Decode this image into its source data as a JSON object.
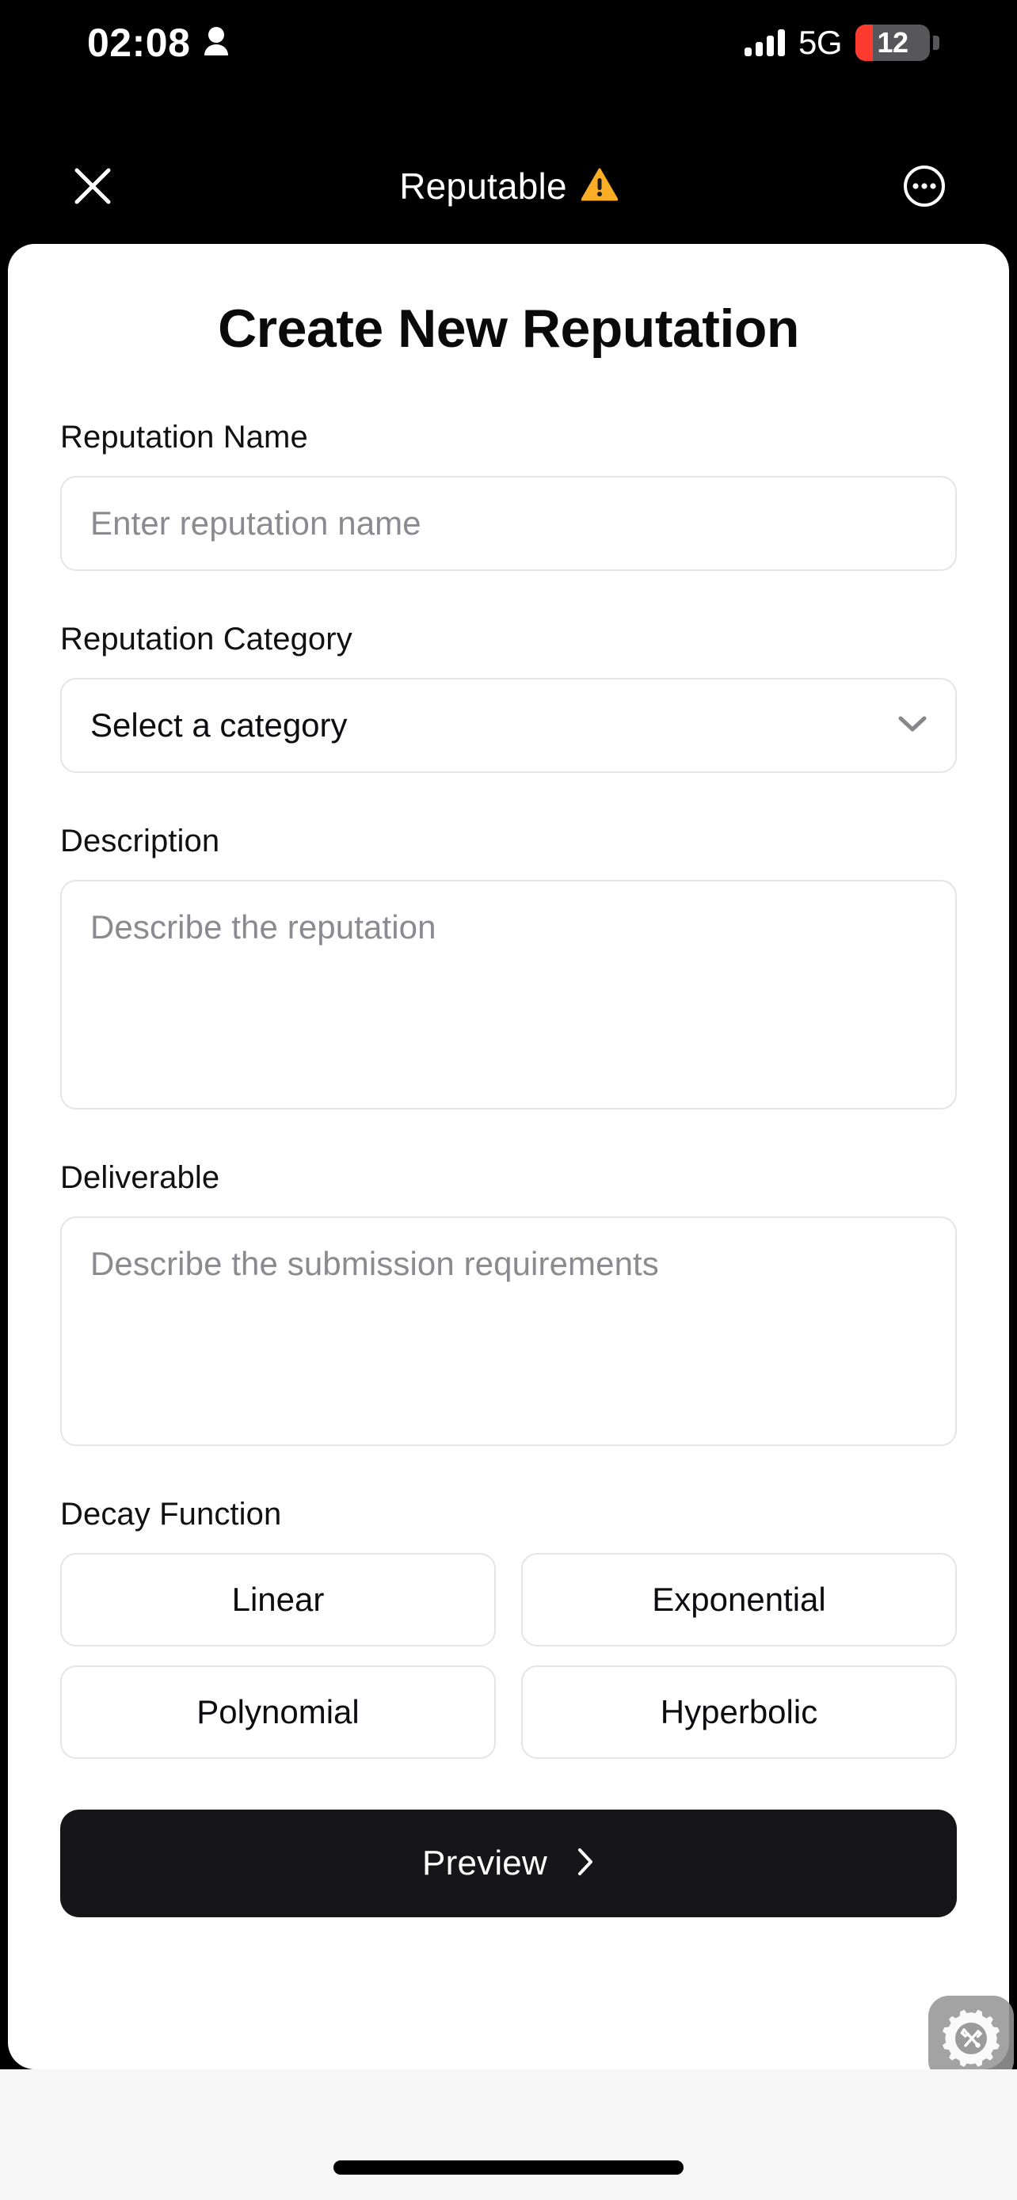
{
  "status_bar": {
    "time": "02:08",
    "person_icon": "person-icon",
    "signal_icon": "signal-bars-icon",
    "network": "5G",
    "battery_percent": "12",
    "battery_color": "#ff3b30"
  },
  "nav_bar": {
    "close_icon": "close-icon",
    "title": "Reputable",
    "warning_icon": "warning-triangle-icon",
    "warning_color": "#fcad26",
    "more_icon": "more-circle-icon"
  },
  "page": {
    "title": "Create New Reputation"
  },
  "form": {
    "reputation_name": {
      "label": "Reputation Name",
      "placeholder": "Enter reputation name",
      "value": ""
    },
    "reputation_category": {
      "label": "Reputation Category",
      "selected": "Select a category",
      "chevron_icon": "chevron-down-icon",
      "options": [
        "Select a category"
      ]
    },
    "description": {
      "label": "Description",
      "placeholder": "Describe the reputation",
      "value": ""
    },
    "deliverable": {
      "label": "Deliverable",
      "placeholder": "Describe the submission requirements",
      "value": ""
    },
    "decay_function": {
      "label": "Decay Function",
      "options": [
        {
          "label": "Linear"
        },
        {
          "label": "Exponential"
        },
        {
          "label": "Polynomial"
        },
        {
          "label": "Hyperbolic"
        }
      ],
      "selected": ""
    },
    "preview_button": {
      "label": "Preview",
      "chevron_icon": "chevron-right-icon",
      "background": "#161618"
    }
  },
  "floating": {
    "dev_tools_icon": "gear-tools-icon"
  },
  "bottom": {
    "home_indicator": "home-indicator"
  }
}
